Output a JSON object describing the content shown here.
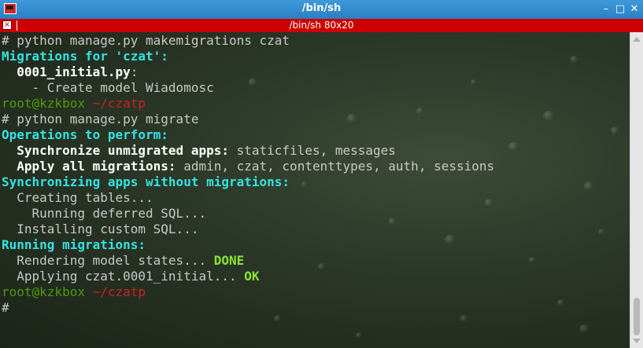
{
  "window": {
    "title": "/bin/sh",
    "minimize_symbol": "–",
    "maximize_symbol": "□",
    "close_symbol": "✕"
  },
  "tab": {
    "title": "/bin/sh 80x20",
    "close_symbol": "×"
  },
  "terminal": {
    "prompt_user": "root@kzkbox",
    "prompt_path": "~/czatp",
    "lines": [
      {
        "segments": [
          {
            "text": "# python manage.py makemigrations czat",
            "style": "plain"
          }
        ]
      },
      {
        "segments": [
          {
            "text": "Migrations for 'czat':",
            "style": "cyan"
          }
        ]
      },
      {
        "segments": [
          {
            "text": "  ",
            "style": "plain"
          },
          {
            "text": "0001_initial.py",
            "style": "white"
          },
          {
            "text": ":",
            "style": "plain"
          }
        ]
      },
      {
        "segments": [
          {
            "text": "    - Create model Wiadomosc",
            "style": "plain"
          }
        ]
      },
      {
        "segments": [
          {
            "text": "root@kzkbox",
            "style": "prompt-green"
          },
          {
            "text": " ~/czatp",
            "style": "prompt-red"
          }
        ]
      },
      {
        "segments": [
          {
            "text": "# python manage.py migrate",
            "style": "plain"
          }
        ]
      },
      {
        "segments": [
          {
            "text": "Operations to perform:",
            "style": "cyan"
          }
        ]
      },
      {
        "segments": [
          {
            "text": "  ",
            "style": "plain"
          },
          {
            "text": "Synchronize unmigrated apps:",
            "style": "white"
          },
          {
            "text": " staticfiles, messages",
            "style": "plain"
          }
        ]
      },
      {
        "segments": [
          {
            "text": "  ",
            "style": "plain"
          },
          {
            "text": "Apply all migrations:",
            "style": "white"
          },
          {
            "text": " admin, czat, contenttypes, auth, sessions",
            "style": "plain"
          }
        ]
      },
      {
        "segments": [
          {
            "text": "Synchronizing apps without migrations:",
            "style": "cyan"
          }
        ]
      },
      {
        "segments": [
          {
            "text": "  Creating tables...",
            "style": "plain"
          }
        ]
      },
      {
        "segments": [
          {
            "text": "    Running deferred SQL...",
            "style": "plain"
          }
        ]
      },
      {
        "segments": [
          {
            "text": "  Installing custom SQL...",
            "style": "plain"
          }
        ]
      },
      {
        "segments": [
          {
            "text": "Running migrations:",
            "style": "cyan"
          }
        ]
      },
      {
        "segments": [
          {
            "text": "  Rendering model states...",
            "style": "plain"
          },
          {
            "text": " DONE",
            "style": "green"
          }
        ]
      },
      {
        "segments": [
          {
            "text": "  Applying czat.0001_initial...",
            "style": "plain"
          },
          {
            "text": " OK",
            "style": "green"
          }
        ]
      },
      {
        "segments": [
          {
            "text": "root@kzkbox",
            "style": "prompt-green"
          },
          {
            "text": " ~/czatp",
            "style": "prompt-red"
          }
        ]
      },
      {
        "segments": [
          {
            "text": "#",
            "style": "plain"
          }
        ]
      }
    ]
  },
  "colors": {
    "titlebar": "#2b7fc4",
    "tabbar": "#cc0000",
    "cyan": "#34e2e2",
    "green": "#8ae234",
    "prompt_green": "#4e9a06",
    "prompt_red": "#cc2222"
  },
  "icons": {
    "app": "terminal-icon",
    "tab_close": "close-icon"
  }
}
